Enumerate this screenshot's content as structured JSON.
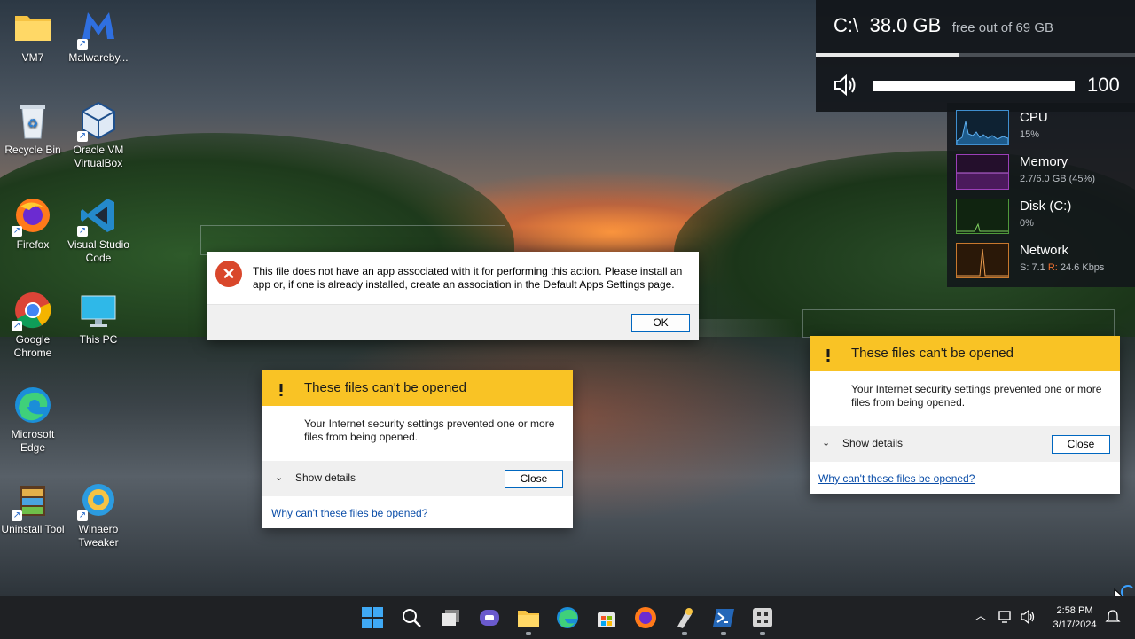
{
  "desktop": {
    "icons": [
      {
        "label": "VM7",
        "icon": "folder-icon"
      },
      {
        "label": "Malwareby...",
        "icon": "malwarebytes-icon"
      },
      {
        "label": "Recycle Bin",
        "icon": "recycle-bin-icon"
      },
      {
        "label": "Oracle VM VirtualBox",
        "icon": "virtualbox-icon"
      },
      {
        "label": "Firefox",
        "icon": "firefox-icon"
      },
      {
        "label": "Visual Studio Code",
        "icon": "vscode-icon"
      },
      {
        "label": "Google Chrome",
        "icon": "chrome-icon"
      },
      {
        "label": "This PC",
        "icon": "this-pc-icon"
      },
      {
        "label": "Microsoft Edge",
        "icon": "edge-icon"
      },
      {
        "label": "Uninstall Tool",
        "icon": "uninstall-tool-icon"
      },
      {
        "label": "Winaero Tweaker",
        "icon": "winaero-tweaker-icon"
      }
    ]
  },
  "drive_widget": {
    "drive": "C:\\",
    "free": "38.0 GB",
    "subtitle": "free out of 69 GB",
    "used_fraction": 0.45,
    "volume": "100",
    "volume_fraction": 1.0
  },
  "perf_widget": {
    "items": [
      {
        "name": "CPU",
        "value": "15%",
        "color": "#3f8fd0"
      },
      {
        "name": "Memory",
        "value": "2.7/6.0 GB (45%)",
        "color": "#9b3fb8"
      },
      {
        "name": "Disk (C:)",
        "value": "0%",
        "color": "#4f9a3a"
      },
      {
        "name": "Network",
        "value_s_label": "S:",
        "value_s": "7.1",
        "value_r_label": "R:",
        "value_r": "24.6 Kbps",
        "color": "#c8782d"
      }
    ]
  },
  "error_dialog": {
    "message": "This file does not have an app associated with it for performing this action. Please install an app or, if one is already installed, create an association in the Default Apps Settings page.",
    "ok_label": "OK"
  },
  "warning_dialogs": [
    {
      "title": "These files can't be opened",
      "message": "Your Internet security settings prevented one or more files from being opened.",
      "details_label": "Show details",
      "close_label": "Close",
      "link": "Why can't these files be opened?"
    },
    {
      "title": "These files can't be opened",
      "message": "Your Internet security settings prevented one or more files from being opened.",
      "details_label": "Show details",
      "close_label": "Close",
      "link": "Why can't these files be opened?"
    }
  ],
  "taskbar": {
    "apps": [
      "start-icon",
      "search-icon",
      "task-view-icon",
      "chat-icon",
      "file-explorer-icon",
      "edge-icon",
      "store-icon",
      "firefox-icon",
      "winaero-tweaker-icon",
      "powershell-icon",
      "app-icon"
    ],
    "time": "2:58 PM",
    "date": "3/17/2024"
  },
  "colors": {
    "warning_yellow": "#f9c325",
    "error_red": "#d9472b",
    "link_blue": "#0a4da8",
    "button_border": "#0067c0"
  }
}
